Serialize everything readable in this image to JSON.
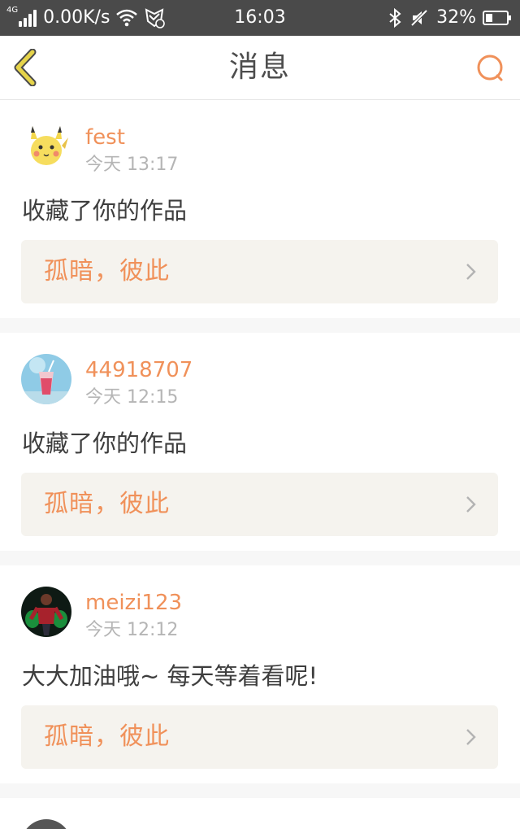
{
  "status_bar": {
    "network_type": "4G",
    "speed": "0.00K/s",
    "time": "16:03",
    "battery": "32%",
    "icons": [
      "signal-icon",
      "wifi-icon",
      "shield-icon",
      "bluetooth-icon",
      "mute-icon",
      "battery-icon"
    ]
  },
  "header": {
    "title": "消息",
    "back_icon": "chevron-left-icon",
    "search_icon": "search-icon",
    "accent_color": "#f0915a"
  },
  "messages": [
    {
      "username": "fest",
      "time": "今天 13:17",
      "text": "收藏了你的作品",
      "work_title": "孤暗，彼此",
      "avatar": "pikachu-avatar"
    },
    {
      "username": "44918707",
      "time": "今天 12:15",
      "text": "收藏了你的作品",
      "work_title": "孤暗，彼此",
      "avatar": "drink-avatar"
    },
    {
      "username": "meizi123",
      "time": "今天 12:12",
      "text": "大大加油哦~ 每天等着看呢!",
      "work_title": "孤暗，彼此",
      "avatar": "character-avatar"
    }
  ]
}
